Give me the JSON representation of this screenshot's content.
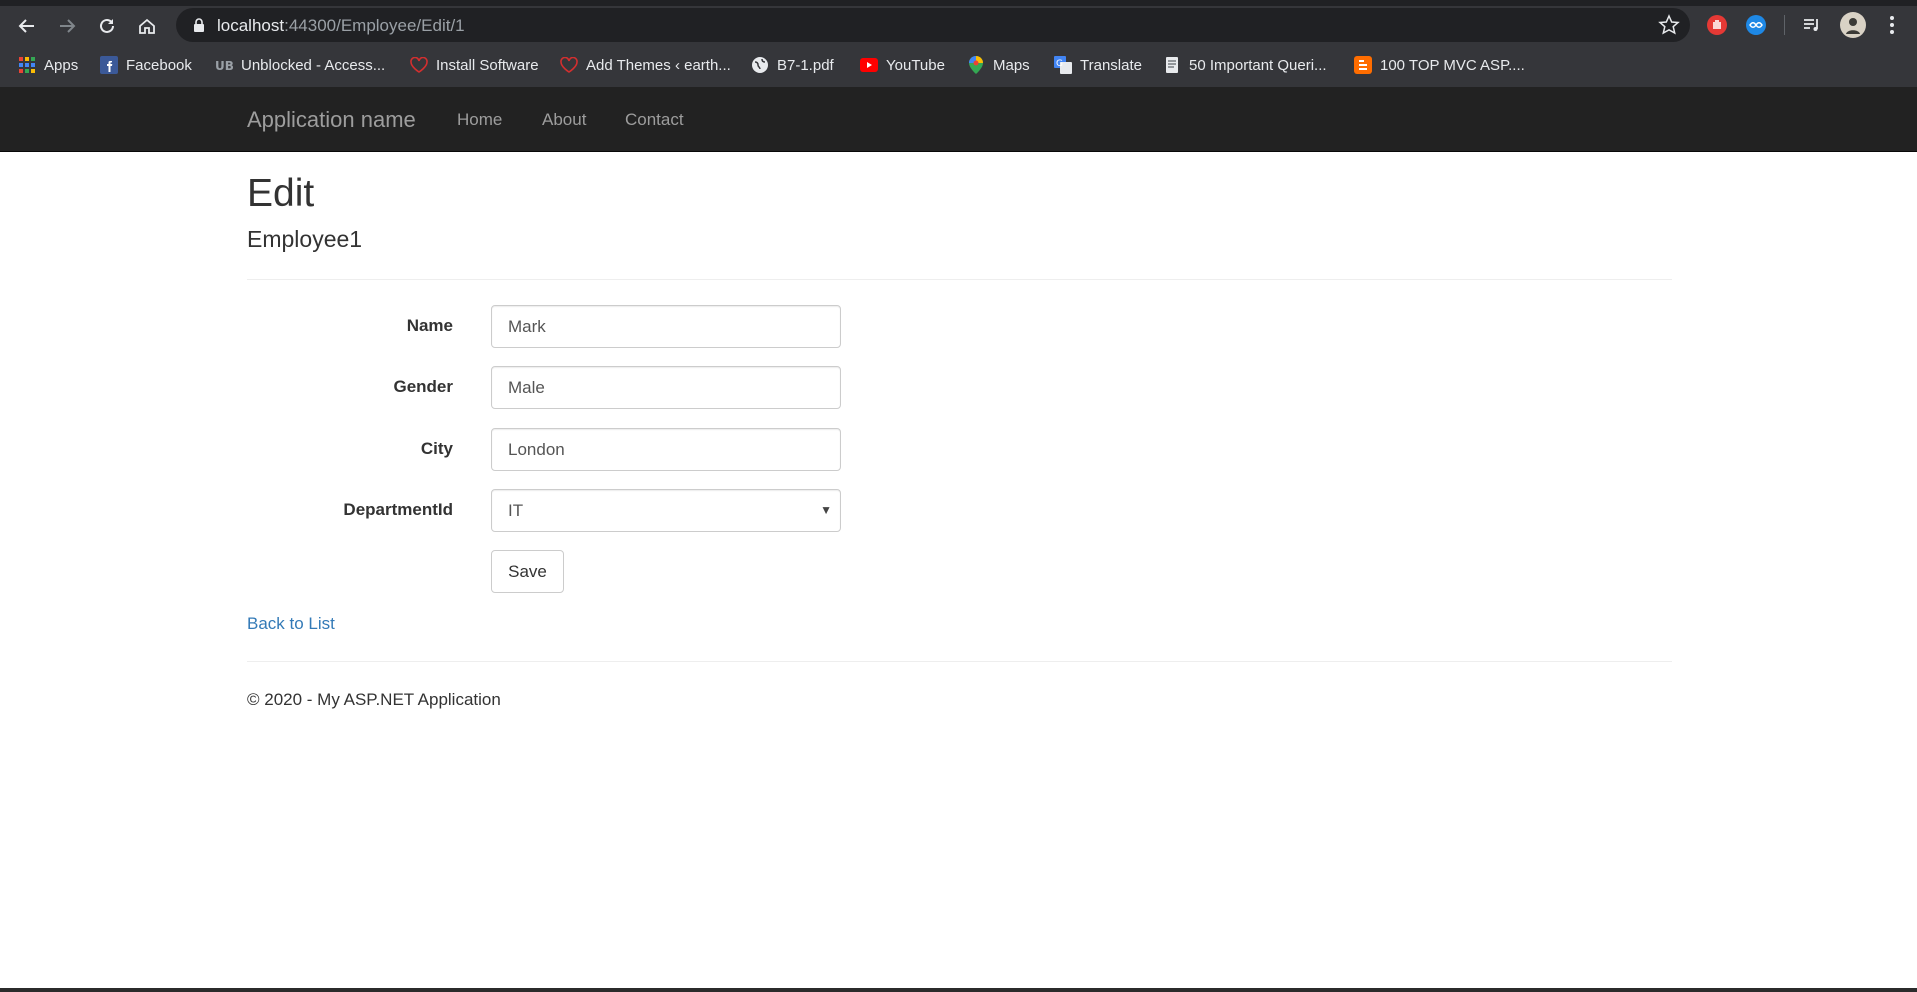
{
  "browser": {
    "url_host": "localhost",
    "url_path": ":44300/Employee/Edit/1",
    "bookmarks": [
      {
        "label": "Apps",
        "icon": "apps-grid-icon"
      },
      {
        "label": "Facebook",
        "icon": "facebook-icon"
      },
      {
        "label": "Unblocked - Access...",
        "icon": "ub-icon"
      },
      {
        "label": "Install Software",
        "icon": "heart-icon"
      },
      {
        "label": "Add Themes ‹ earth...",
        "icon": "heart-icon"
      },
      {
        "label": "B7-1.pdf",
        "icon": "globe-icon"
      },
      {
        "label": "YouTube",
        "icon": "youtube-icon"
      },
      {
        "label": "Maps",
        "icon": "maps-pin-icon"
      },
      {
        "label": "Translate",
        "icon": "translate-icon"
      },
      {
        "label": "50 Important Queri...",
        "icon": "doc-icon"
      },
      {
        "label": "100 TOP MVC ASP....",
        "icon": "blogger-icon"
      }
    ]
  },
  "navbar": {
    "brand": "Application name",
    "links": [
      "Home",
      "About",
      "Contact"
    ]
  },
  "page": {
    "title": "Edit",
    "subtitle": "Employee1"
  },
  "form": {
    "fields": [
      {
        "label": "Name",
        "value": "Mark"
      },
      {
        "label": "Gender",
        "value": "Male"
      },
      {
        "label": "City",
        "value": "London"
      },
      {
        "label": "DepartmentId",
        "value": "IT"
      }
    ],
    "save_label": "Save"
  },
  "links": {
    "back": "Back to List"
  },
  "footer": {
    "text": "© 2020 - My ASP.NET Application"
  },
  "colors": {
    "navbar_bg": "#222222",
    "link": "#337ab7",
    "chrome_bg": "#35363a"
  }
}
